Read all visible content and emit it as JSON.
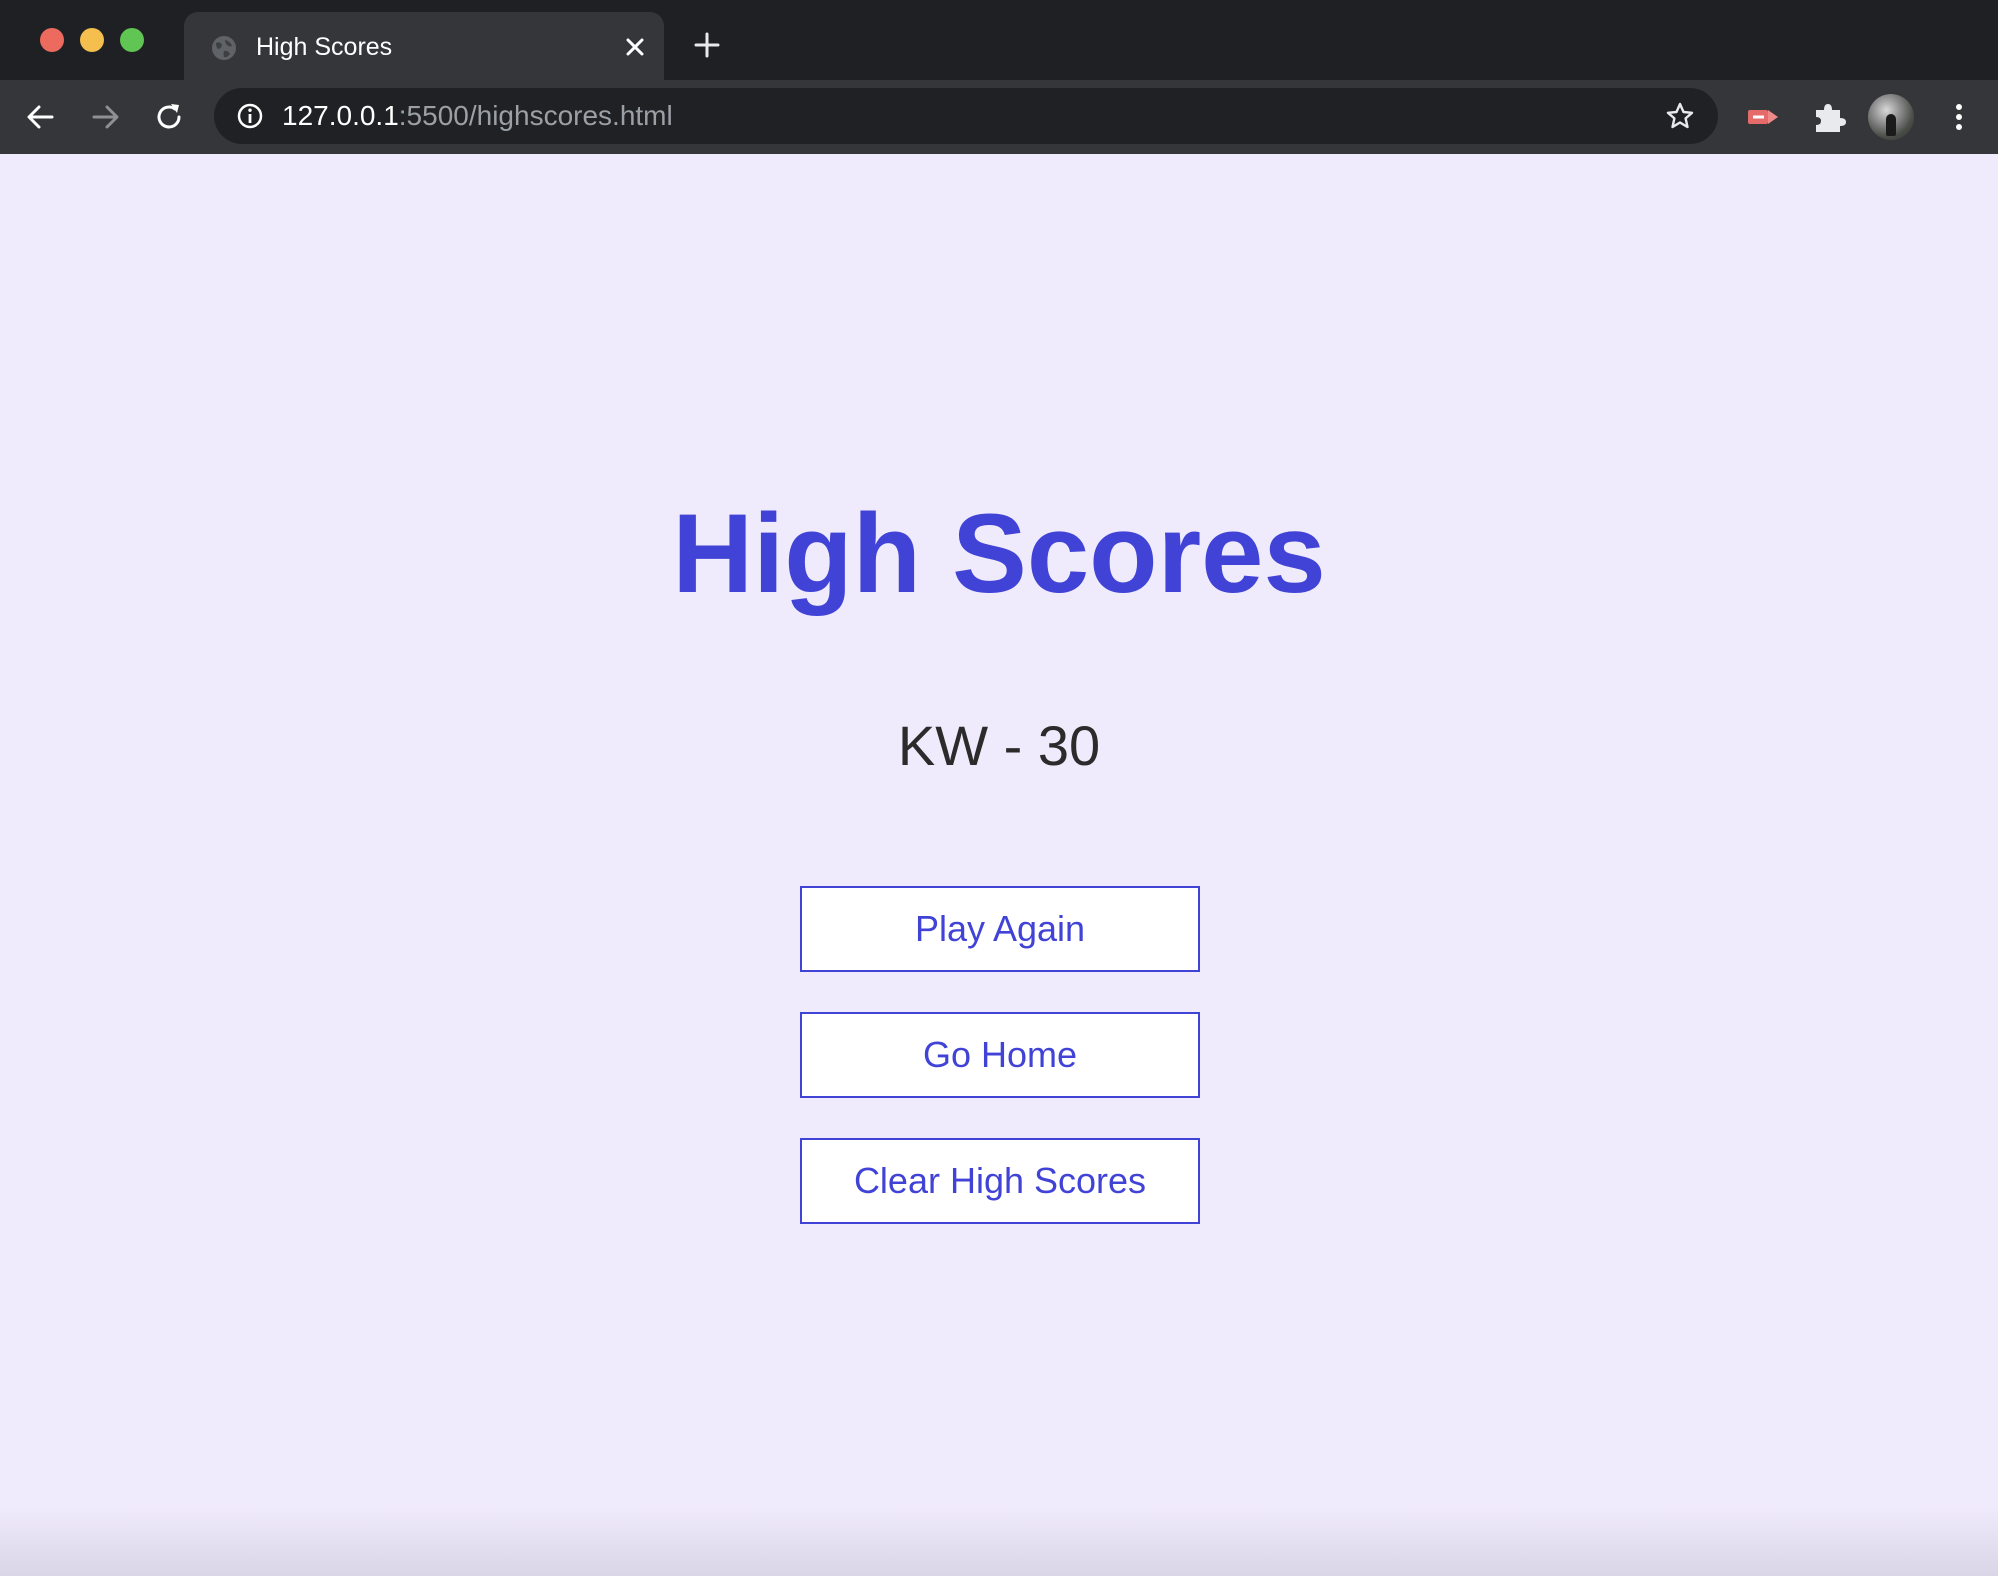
{
  "browser": {
    "tab": {
      "title": "High Scores",
      "favicon": "globe-icon",
      "close_icon": "close-icon"
    },
    "new_tab_icon": "plus-icon",
    "toolbar": {
      "back_icon": "arrow-left-icon",
      "forward_icon": "arrow-right-icon",
      "reload_icon": "reload-icon",
      "url_host": "127.0.0.1",
      "url_path": ":5500/highscores.html",
      "info_icon": "info-icon",
      "bookmark_icon": "star-icon",
      "extensions": [
        "red-extension-icon",
        "puzzle-icon"
      ],
      "menu_icon": "kebab-menu-icon"
    }
  },
  "page": {
    "title": "High Scores",
    "scores": [
      "KW - 30"
    ],
    "buttons": {
      "play_again": "Play Again",
      "go_home": "Go Home",
      "clear_high_scores": "Clear High Scores"
    }
  },
  "colors": {
    "accent": "#4143d6",
    "page_background": "#efeafc",
    "score_text": "#2b2b2b",
    "chrome_dark": "#1f2023",
    "chrome_toolbar": "#35363a"
  }
}
